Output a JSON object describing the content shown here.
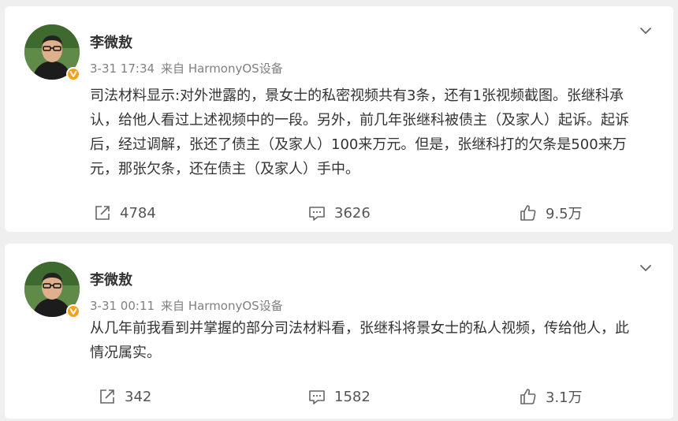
{
  "posts": [
    {
      "author": "李微敖",
      "time": "3-31 17:34",
      "source": "来自 HarmonyOS设备",
      "content": "司法材料显示:对外泄露的，景女士的私密视频共有3条，还有1张视频截图。张继科承认，给他人看过上述视频中的一段。另外，前几年张继科被债主（及家人）起诉。起诉后，经过调解，张还了债主（及家人）100来万元。但是，张继科打的欠条是500来万元，那张欠条，还在债主（及家人）手中。",
      "reposts": "4784",
      "comments": "3626",
      "likes": "9.5万"
    },
    {
      "author": "李微敖",
      "time": "3-31 00:11",
      "source": "来自 HarmonyOS设备",
      "content": "从几年前我看到并掌握的部分司法材料看，张继科将景女士的私人视频，传给他人，此情况属实。",
      "reposts": "342",
      "comments": "1582",
      "likes": "3.1万"
    }
  ],
  "icons": {
    "repost": "repost-icon",
    "comment": "comment-icon",
    "like": "like-icon",
    "menu": "chevron-down-icon",
    "verified": "verified-badge-icon"
  },
  "colors": {
    "verified_badge": "#f4a019",
    "meta_text": "#808080",
    "background": "#efefef"
  }
}
